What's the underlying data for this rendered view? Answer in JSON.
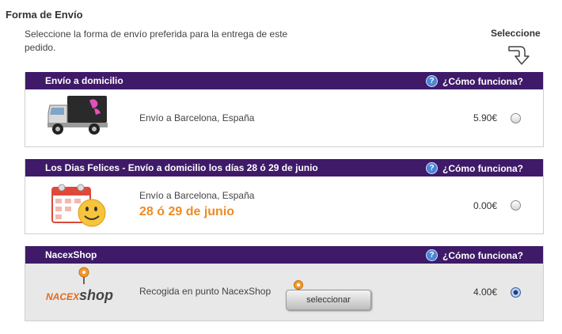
{
  "header": {
    "title": "Forma de Envío",
    "intro": "Seleccione la forma de envío preferida para la entrega de este pedido.",
    "select_label": "Seleccione"
  },
  "options": [
    {
      "title": "Envío a domicilio",
      "help_label": "¿Cómo funciona?",
      "description": "Envío a Barcelona, España",
      "price": "5.90€",
      "selected": false,
      "icon": "delivery-truck-icon"
    },
    {
      "title": "Los Dias Felices - Envío a domicilio los días 28 ó 29 de junio",
      "help_label": "¿Cómo funciona?",
      "description": "Envío a Barcelona, España",
      "dates": "28 ó 29 de junio",
      "price": "0.00€",
      "selected": false,
      "icon": "calendar-smiley-icon"
    },
    {
      "title": "NacexShop",
      "help_label": "¿Cómo funciona?",
      "description": "Recogida en punto NacexShop",
      "button_label": "seleccionar",
      "logo_text_left": "NACEX",
      "logo_text_right": "shop",
      "price": "4.00€",
      "selected": true,
      "icon": "nacex-shop-logo"
    }
  ],
  "colors": {
    "header_bg": "#3e1a68",
    "accent_orange": "#ef8b23",
    "help_icon": "#4a86d8"
  }
}
